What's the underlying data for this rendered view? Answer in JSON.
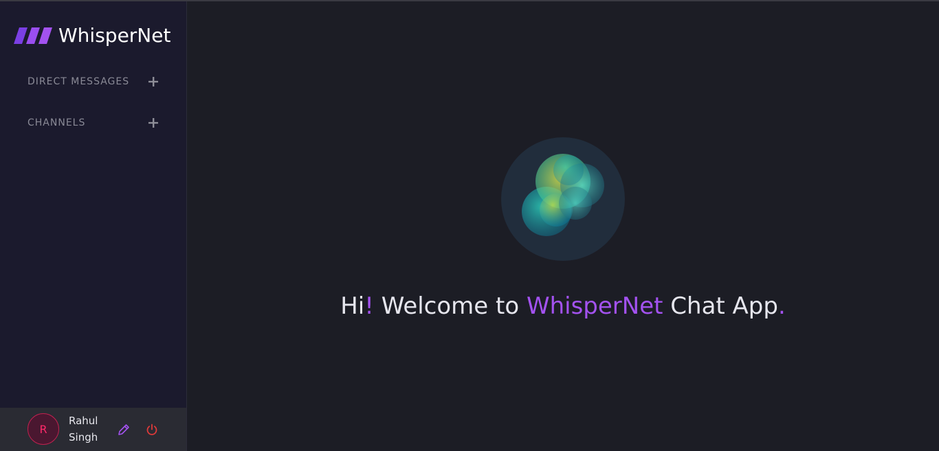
{
  "app": {
    "brand_name": "WhisperNet",
    "brand_color": "#a352f0"
  },
  "sidebar": {
    "sections": [
      {
        "label": "DIRECT MESSAGES",
        "action_icon": "plus-icon"
      },
      {
        "label": "CHANNELS",
        "action_icon": "plus-icon"
      }
    ]
  },
  "user": {
    "initial": "R",
    "first_name": "Rahul",
    "last_name": "Singh",
    "edit_icon": "pencil-icon",
    "logout_icon": "power-icon",
    "avatar_color": "#ff2a6a",
    "logout_color": "#e03a3a"
  },
  "welcome": {
    "hi": "Hi",
    "exclaim": "!",
    "middle": "Welcome to",
    "app_name": "WhisperNet",
    "suffix": "Chat App",
    "period": "."
  }
}
